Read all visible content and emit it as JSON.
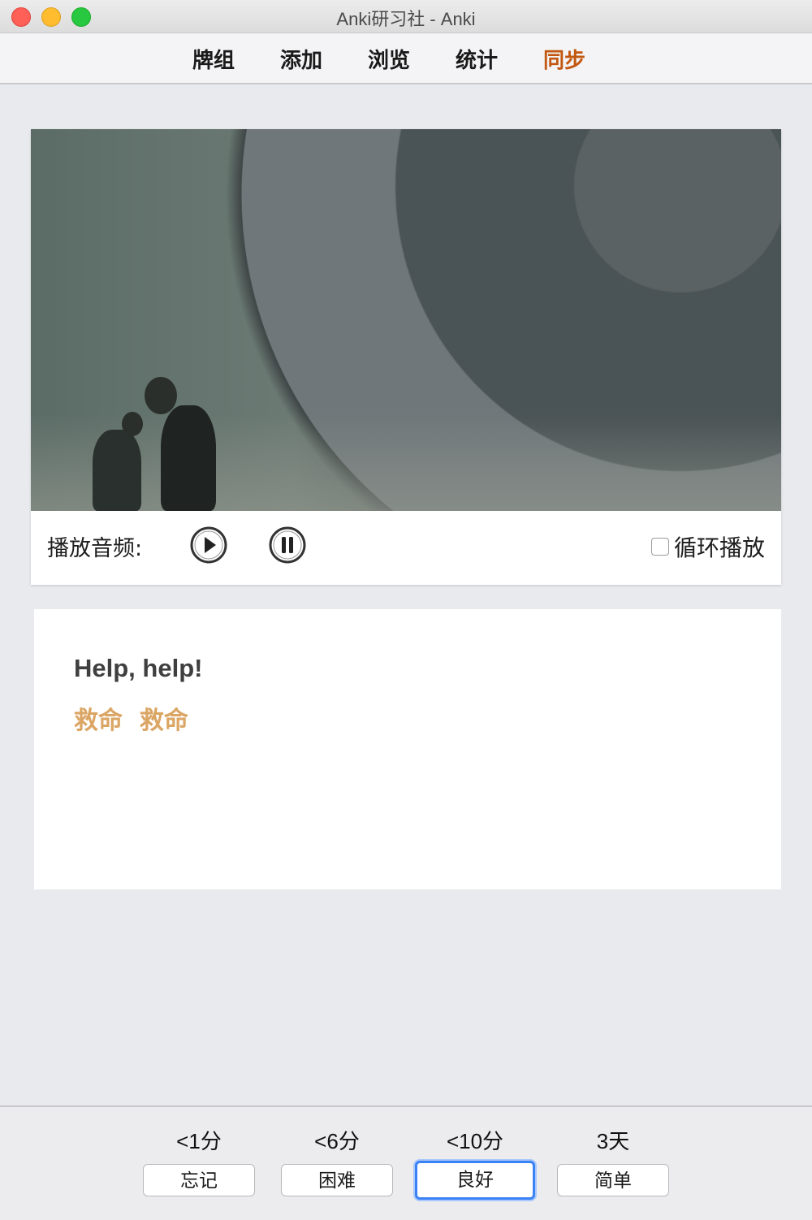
{
  "window": {
    "title": "Anki研习社 - Anki"
  },
  "toolbar": {
    "items": [
      {
        "label": "牌组"
      },
      {
        "label": "添加"
      },
      {
        "label": "浏览"
      },
      {
        "label": "统计"
      },
      {
        "label": "同步"
      }
    ],
    "sync_color": "#c2580f"
  },
  "media": {
    "audio_label": "播放音频:",
    "play_icon": "play-circle-icon",
    "pause_icon": "pause-circle-icon",
    "loop_label": "循环播放",
    "loop_checked": false
  },
  "card": {
    "english": "Help, help!",
    "chinese": "救命  救命",
    "chinese_color": "#dba564"
  },
  "review": {
    "options": [
      {
        "interval": "<1分",
        "label": "忘记",
        "focused": false
      },
      {
        "interval": "<6分",
        "label": "困难",
        "focused": false
      },
      {
        "interval": "<10分",
        "label": "良好",
        "focused": true
      },
      {
        "interval": "3天",
        "label": "简单",
        "focused": false
      }
    ],
    "focus_color": "#3b82f6"
  }
}
